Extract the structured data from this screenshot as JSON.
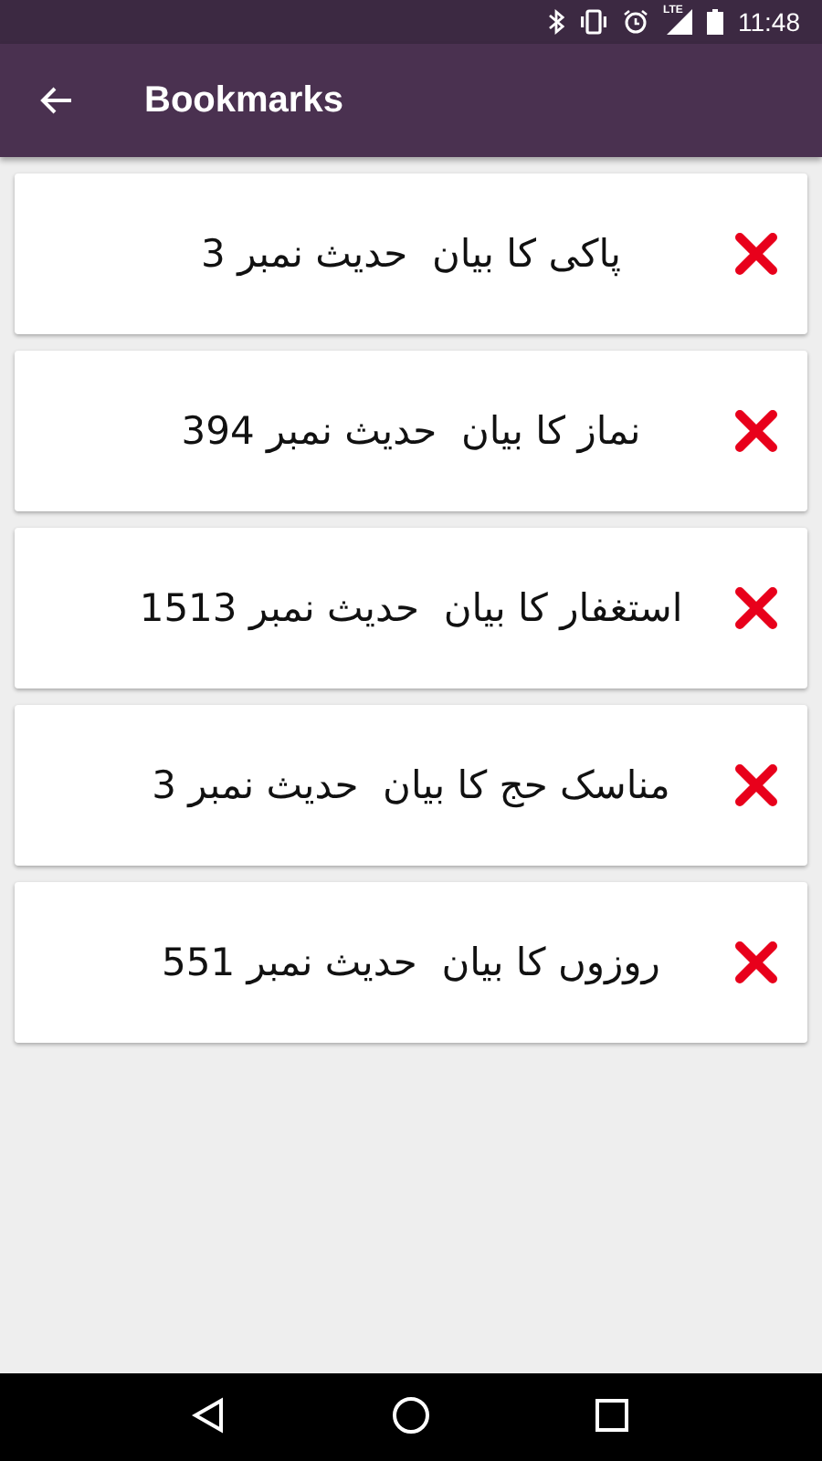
{
  "status_bar": {
    "network_label": "LTE",
    "time": "11:48"
  },
  "app_bar": {
    "title": "Bookmarks"
  },
  "bookmarks": [
    {
      "text": "پاکی کا بیان  حدیث نمبر 3"
    },
    {
      "text": "نماز کا بیان  حدیث نمبر 394"
    },
    {
      "text": "استغفار کا بیان  حدیث نمبر 1513"
    },
    {
      "text": "مناسک حج کا بیان  حدیث نمبر 3"
    },
    {
      "text": "روزوں کا بیان  حدیث نمبر 551"
    }
  ]
}
